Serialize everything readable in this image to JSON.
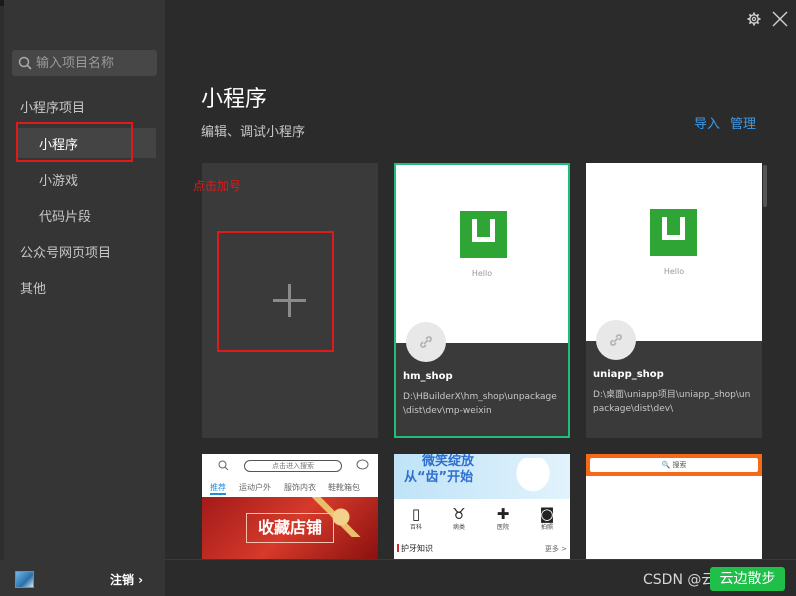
{
  "sidebar": {
    "search_placeholder": "输入项目名称",
    "groups": [
      {
        "label": "小程序项目"
      },
      {
        "label": "公众号网页项目"
      },
      {
        "label": "其他"
      }
    ],
    "sub_items": [
      {
        "label": "小程序",
        "active": true
      },
      {
        "label": "小游戏"
      },
      {
        "label": "代码片段"
      }
    ],
    "logout_label": "注销 ›"
  },
  "main": {
    "title": "小程序",
    "subtitle": "编辑、调试小程序",
    "import_label": "导入",
    "manage_label": "管理",
    "annotation": "点击加号"
  },
  "projects": [
    {
      "name": "hm_shop",
      "path": "D:\\HBuilderX\\hm_shop\\unpackage\\dist\\dev\\mp-weixin",
      "thumb_text": "Hello",
      "selected": true
    },
    {
      "name": "uniapp_shop",
      "path": "D:\\桌面\\uniapp项目\\uniapp_shop\\unpackage\\dist\\dev\\",
      "thumb_text": "Hello",
      "selected": false
    }
  ],
  "previews": {
    "p1": {
      "search": "点击进入搜索",
      "tabs": [
        "推荐",
        "运动户外",
        "服饰内衣",
        "鞋靴箱包"
      ],
      "banner": "收藏店铺"
    },
    "p2": {
      "line1": "微笑绽放",
      "line2": "从“齿”开始",
      "icons": [
        {
          "icon": "book",
          "label": "百科"
        },
        {
          "icon": "tooth",
          "label": "病类"
        },
        {
          "icon": "hospital",
          "label": "医院"
        },
        {
          "icon": "camera",
          "label": "拍照"
        }
      ],
      "section": "护牙知识",
      "more": "更多 >"
    },
    "p3": {
      "search": "🔍 搜索"
    }
  },
  "footer": {
    "watermark": "CSDN @云边散步",
    "cloud_button": "云边散步"
  },
  "colors": {
    "accent_green": "#1fbf7a",
    "link_blue": "#3d9be9",
    "annotation_red": "#e0191a",
    "logo_green": "#2ea535"
  }
}
